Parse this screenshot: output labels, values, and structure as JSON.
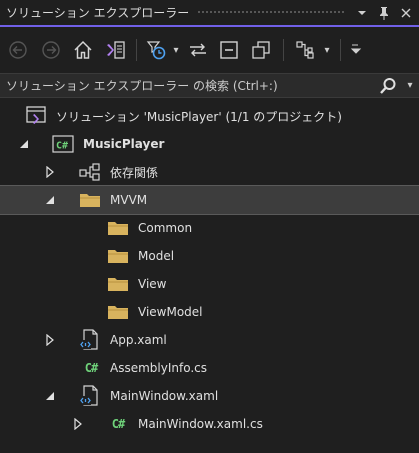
{
  "window": {
    "title": "ソリューション エクスプローラー",
    "dropdown_glyph": "▾",
    "pin_glyph": "📌",
    "close_glyph": "✕"
  },
  "toolbar": {
    "icons": [
      "back-icon",
      "forward-icon",
      "home-icon",
      "switch-views-icon",
      "pending-changes-filter-icon",
      "sync-with-document-icon",
      "collapse-all-icon",
      "show-all-files-icon",
      "properties-icon"
    ],
    "dropdown_glyph": "▾"
  },
  "search": {
    "placeholder": "ソリューション エクスプローラー の検索 (Ctrl+:)",
    "dropdown_glyph": "▾"
  },
  "tree": {
    "solution": "ソリューション 'MusicPlayer' (1/1 のプロジェクト)",
    "project": "MusicPlayer",
    "project_badge": "C#",
    "dependencies": "依存関係",
    "mvvm": "MVVM",
    "common": "Common",
    "model": "Model",
    "view": "View",
    "viewmodel": "ViewModel",
    "app_xaml": "App.xaml",
    "assembly_info": "AssemblyInfo.cs",
    "main_window": "MainWindow.xaml",
    "main_window_cs": "MainWindow.xaml.cs",
    "cs_badge": "C#"
  },
  "colors": {
    "accent": "#7160e8",
    "folder": "#d8b35e",
    "csharp": "#6fd27a",
    "selected": "#3d3d3d"
  }
}
